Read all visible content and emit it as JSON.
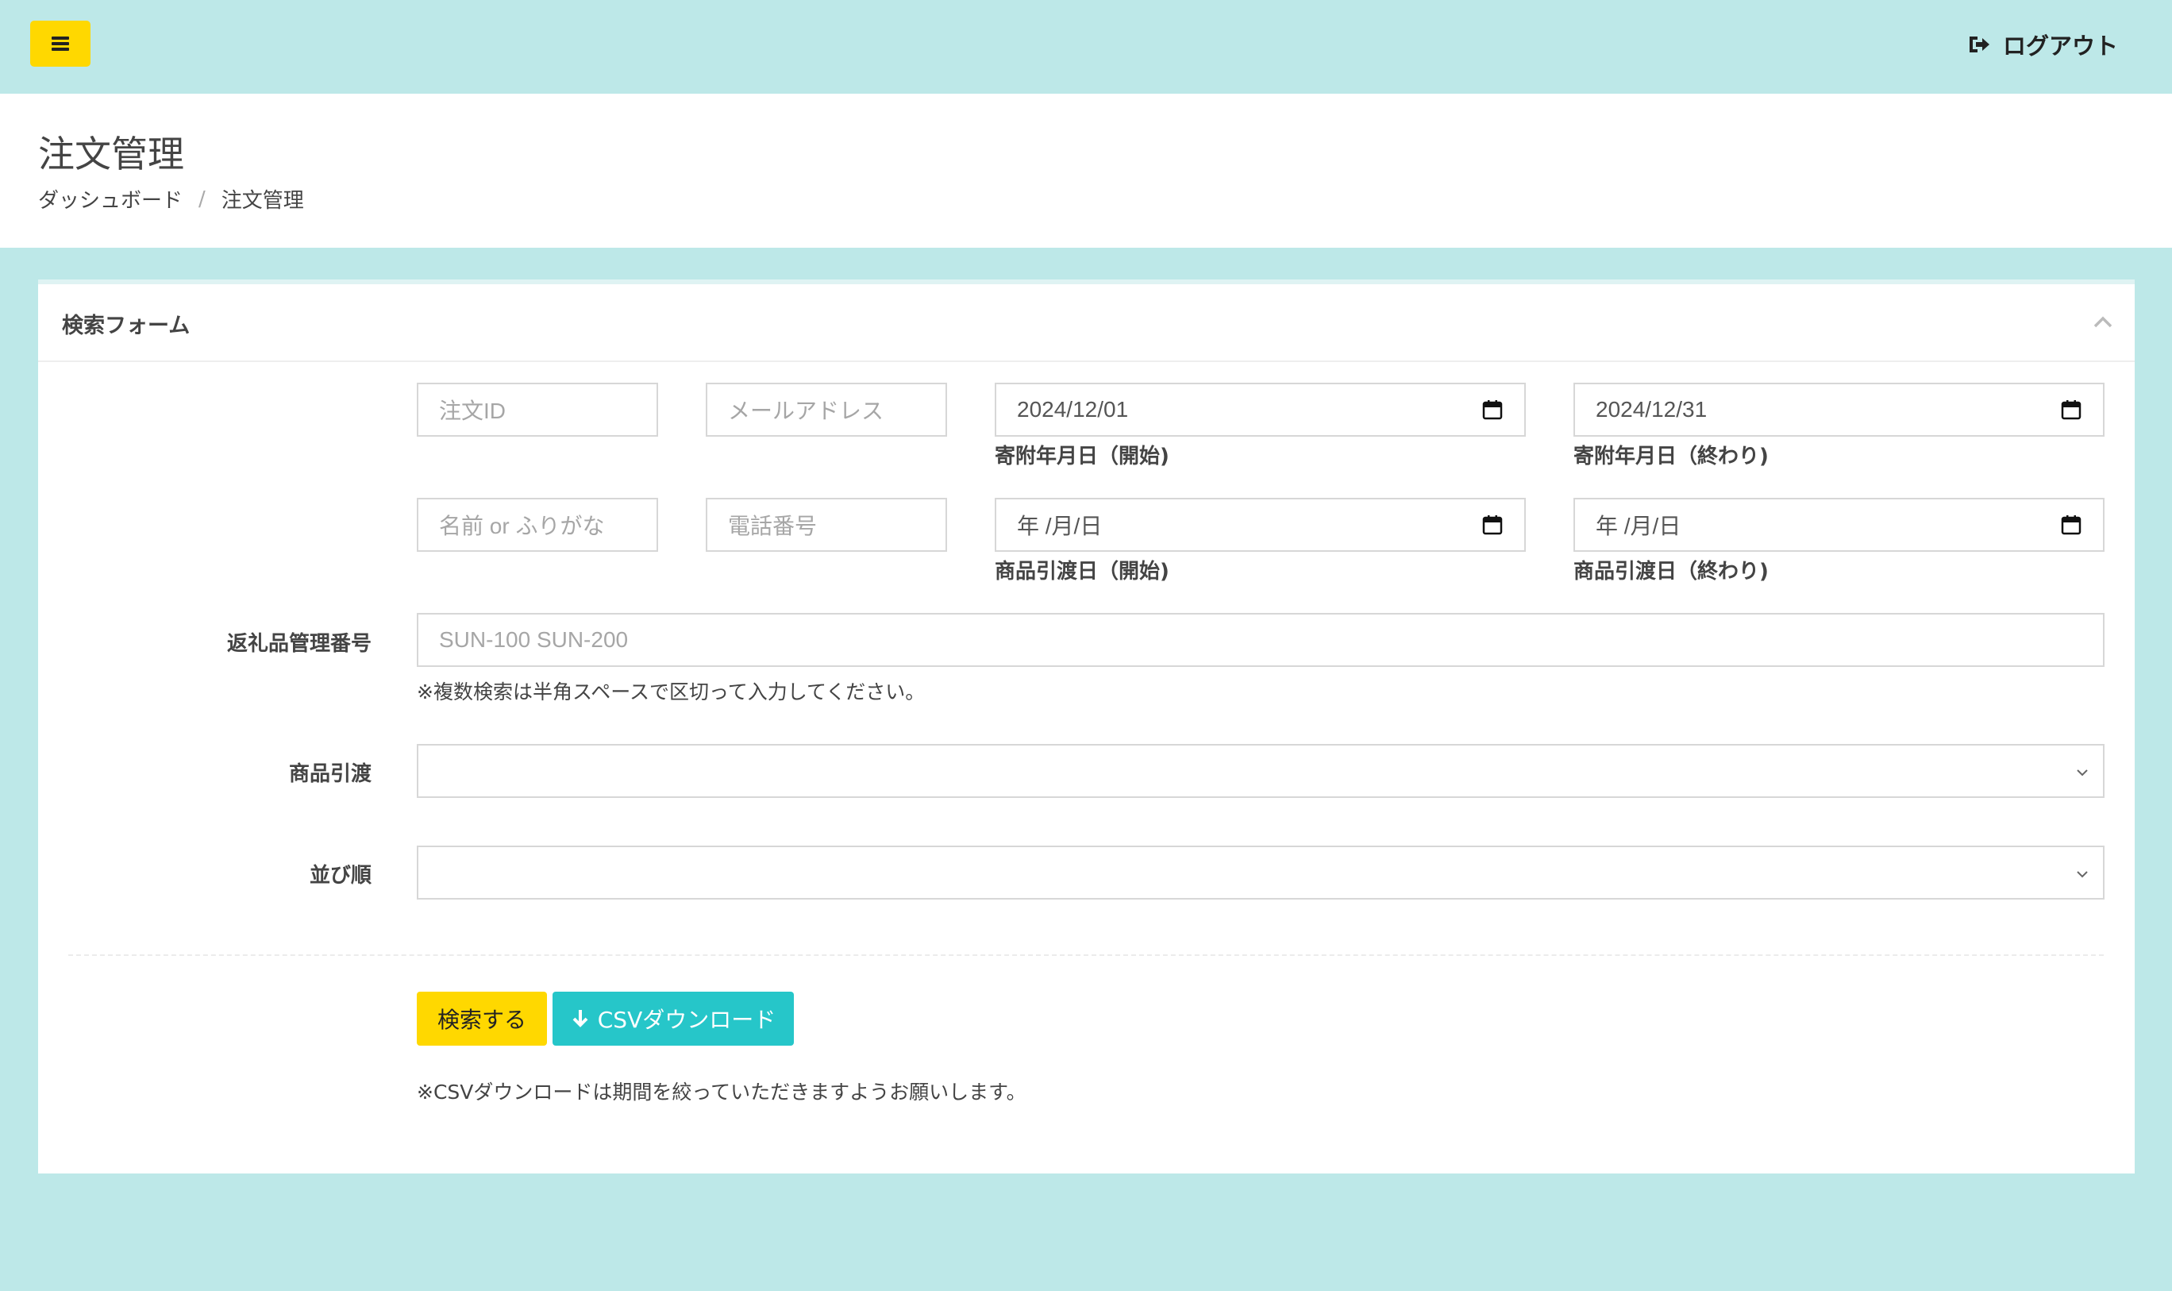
{
  "topbar": {
    "logout_label": "ログアウト",
    "menu_icon": "hamburger-icon",
    "logout_icon": "sign-out-icon",
    "menu_color": "#ffd800",
    "bg_color": "#bde8e8"
  },
  "header": {
    "title": "注文管理",
    "breadcrumb": [
      "ダッシュボード",
      "/",
      "注文管理"
    ]
  },
  "search_form": {
    "title": "検索フォーム",
    "order_id_placeholder": "注文ID",
    "email_placeholder": "メールアドレス",
    "donation_start_value": "2024/12/01",
    "donation_start_label": "寄附年月日（開始)",
    "donation_end_value": "2024/12/31",
    "donation_end_label": "寄附年月日（終わり)",
    "name_placeholder": "名前 or ふりがな",
    "phone_placeholder": "電話番号",
    "delivery_start_value": "年 /月/日",
    "delivery_start_label": "商品引渡日（開始)",
    "delivery_end_value": "年 /月/日",
    "delivery_end_label": "商品引渡日（終わり)",
    "gift_number_label": "返礼品管理番号",
    "gift_number_placeholder": "SUN-100 SUN-200",
    "gift_number_note": "※複数検索は半角スペースで区切って入力してください。",
    "delivery_label": "商品引渡",
    "delivery_value": "",
    "sort_label": "並び順",
    "sort_value": "",
    "search_button": "検索する",
    "csv_button": "CSVダウンロード",
    "csv_note": "※CSVダウンロードは期間を絞っていただきますようお願いします。",
    "search_button_color": "#ffd800",
    "csv_button_color": "#26c6c9"
  }
}
